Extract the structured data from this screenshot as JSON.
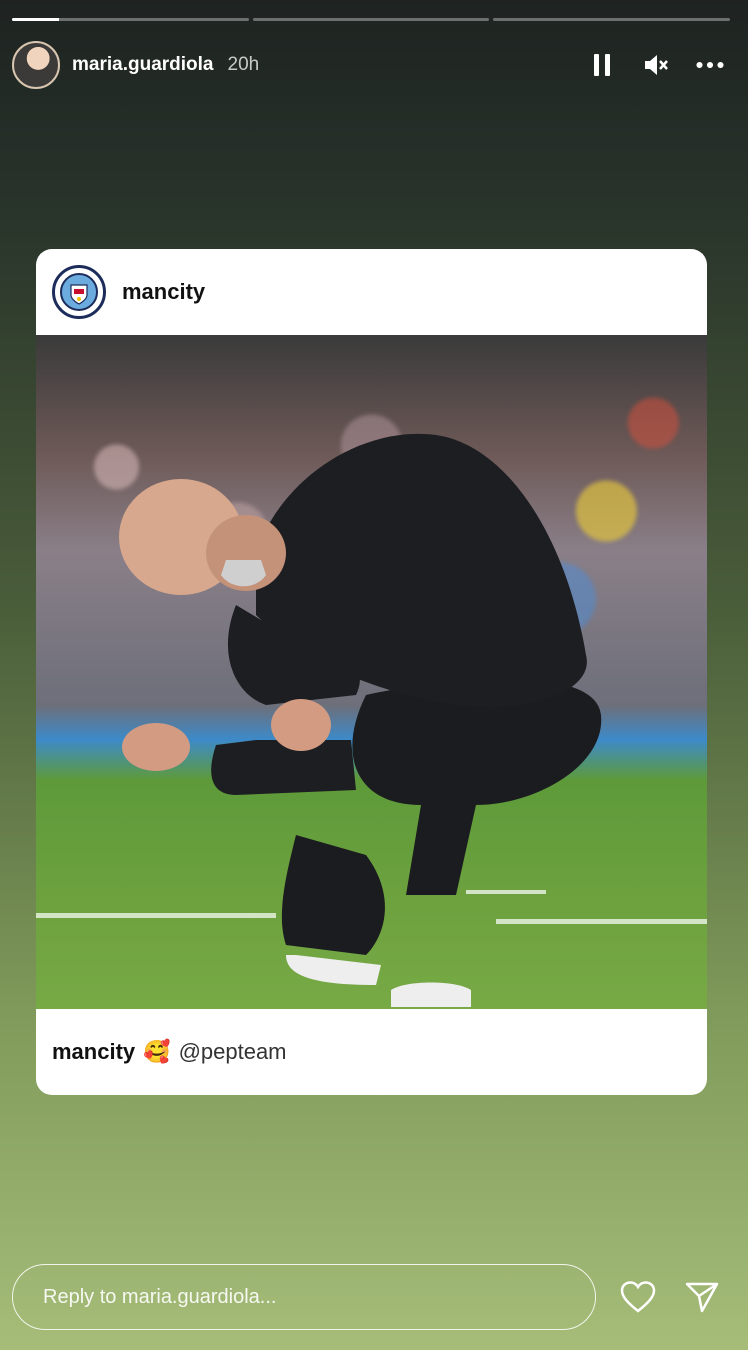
{
  "story": {
    "progress": [
      1,
      0,
      0
    ]
  },
  "header": {
    "username": "maria.guardiola",
    "time": "20h",
    "icons": [
      "pause-icon",
      "mute-icon",
      "more-icon"
    ]
  },
  "shared_post": {
    "author": "mancity",
    "caption": {
      "user": "mancity",
      "emoji": "🥰",
      "mention": "@pepteam"
    }
  },
  "footer": {
    "reply_placeholder": "Reply to maria.guardiola...",
    "icons": [
      "heart-icon",
      "send-icon"
    ]
  }
}
